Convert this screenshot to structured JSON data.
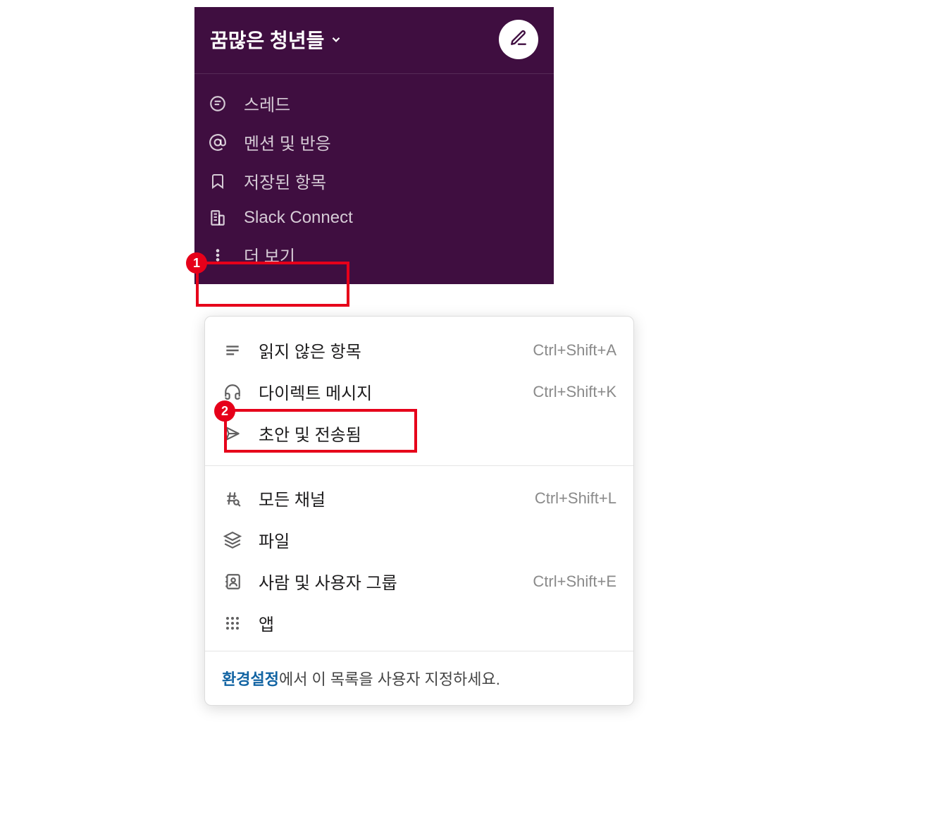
{
  "workspace": {
    "name": "꿈많은 청년들"
  },
  "nav": {
    "threads": "스레드",
    "mentions": "멘션 및 반응",
    "saved": "저장된 항목",
    "slack_connect": "Slack Connect",
    "more": "더 보기"
  },
  "popup": {
    "unreads": {
      "label": "읽지 않은 항목",
      "shortcut": "Ctrl+Shift+A"
    },
    "dms": {
      "label": "다이렉트 메시지",
      "shortcut": "Ctrl+Shift+K"
    },
    "drafts": {
      "label": "초안 및 전송됨",
      "shortcut": ""
    },
    "all_channels": {
      "label": "모든 채널",
      "shortcut": "Ctrl+Shift+L"
    },
    "files": {
      "label": "파일",
      "shortcut": ""
    },
    "people": {
      "label": "사람 및 사용자 그룹",
      "shortcut": "Ctrl+Shift+E"
    },
    "apps": {
      "label": "앱",
      "shortcut": ""
    },
    "footer_link": "환경설정",
    "footer_text": "에서 이 목록을 사용자 지정하세요."
  },
  "callouts": {
    "one": "1",
    "two": "2"
  }
}
